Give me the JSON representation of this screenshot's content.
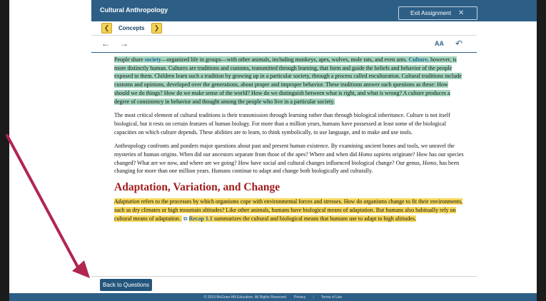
{
  "app": {
    "title": "Cultural Anthropology",
    "exit_label": "Exit Assignment",
    "exit_icon": "close-icon"
  },
  "nav": {
    "concepts_label": "Concepts",
    "prev_icon": "chevron-left-icon",
    "next_icon": "chevron-right-icon"
  },
  "toolbar": {
    "back_icon": "arrow-left-icon",
    "forward_icon": "arrow-right-icon",
    "text_size_label": "AA",
    "undo_icon": "return-icon"
  },
  "content": {
    "p1": {
      "t1": "People share ",
      "link1": "society",
      "t2": "—organized life in groups—with other animals, including monkeys, apes, wolves, mole rats, and even ants. ",
      "link2": "Culture,",
      "t3": " however, is more distinctly human. Cultures are traditions and customs, transmitted through learning, that form and guide the beliefs and behavior of the people exposed to them. Children learn such a tradition by growing up in a particular society, through a process called enculturation. Cultural traditions include customs and opinions, developed over the generations, about proper and improper behavior. These traditions answer such questions as these: How should we do things? How do we make sense of the world? How do we distinguish between what is right, and what is wrong? A culture produces a degree of consistency in behavior and thought among the people who live in a particular society."
    },
    "p2": "The most critical element of cultural traditions is their transmission through learning rather than through biological inheritance. Culture is not itself biological, but it rests on certain features of human biology. For more than a million years, humans have possessed at least some of the biological capacities on which culture depends. These abilities are to learn, to think symbolically, to use language, and to make and use tools.",
    "p3": {
      "t1": "Anthropology confronts and ponders major questions about past and present human existence. By examining ancient bones and tools, we unravel the mysteries of human origins. When did our ancestors separate from those of the apes? Where and when did ",
      "i1": "Homo sapiens",
      "t2": " originate? How has our species changed? What are we now, and where are we going? How have social and cultural changes influenced biological change? Our genus, ",
      "i2": "Homo,",
      "t3": " has been changing for more than one million years. Humans continue to adapt and change both biologically and culturally."
    },
    "heading": "Adaptation, Variation, and Change",
    "p4": {
      "i1": "Adaptation",
      "t1": " refers to the processes by which organisms cope with environmental forces and stresses. How do organisms change to fit their environments, such as dry climates or high mountain altitudes? Like other animals, humans have biological means of adaptation. But humans also habitually rely on cultural means of adaptation. ",
      "recap_icon": "recap-icon",
      "recap_link": "Recap 1.1",
      "t2": " summarizes the cultural and biological means that humans use to adapt to high altitudes."
    }
  },
  "bottom": {
    "back_label": "Back to Questions"
  },
  "footer": {
    "copyright": "© 2019 McGraw-Hill Education. All Rights Reserved.",
    "privacy": "Privacy",
    "sep": "|",
    "terms": "Terms of Use"
  },
  "colors": {
    "topbar": "#2d5f86",
    "highlight_green": "#a4d7bf",
    "highlight_yellow": "#f6d85b",
    "heading": "#a11c1c",
    "annotation_arrow": "#b0264f"
  }
}
